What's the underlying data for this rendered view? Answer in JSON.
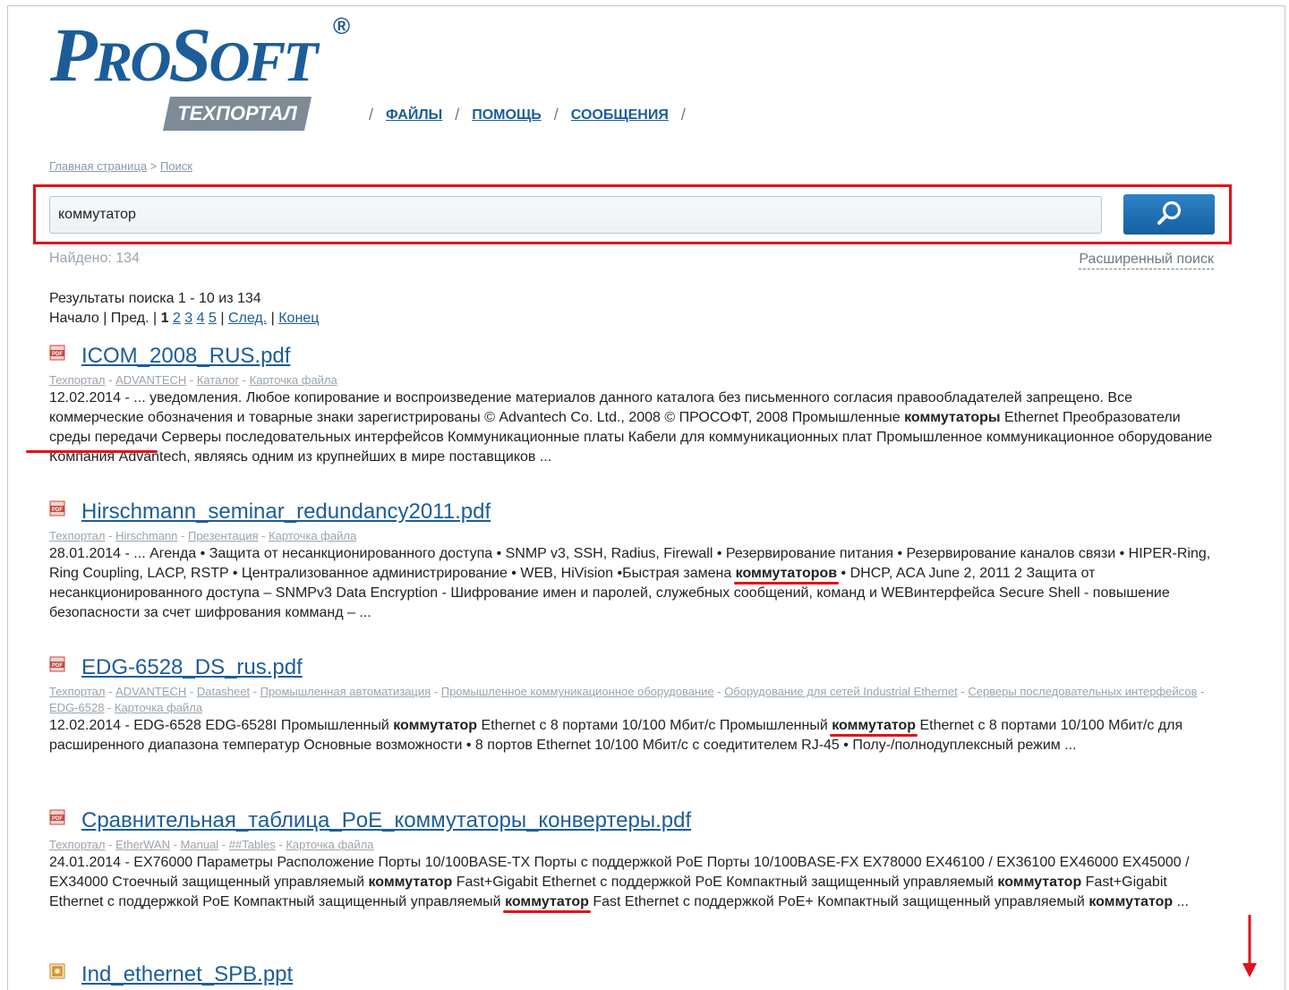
{
  "logo": {
    "word_p": "P",
    "word_ro": "RO",
    "word_s": "S",
    "word_oft": "OFT",
    "reg": "®",
    "band": "ТЕХПОРТАЛ"
  },
  "nav": {
    "items": [
      "ФАЙЛЫ",
      "ПОМОЩЬ",
      "СООБЩЕНИЯ"
    ],
    "sep": "/"
  },
  "breadcrumb": {
    "home": "Главная страница",
    "sep": " > ",
    "current": "Поиск"
  },
  "search": {
    "value": "коммутатор",
    "button_icon": "magnifier-icon"
  },
  "found": "Найдено: 134",
  "advanced": "Расширенный поиск",
  "summary": {
    "line1": "Результаты поиска 1 - 10 из 134",
    "start": "Начало",
    "prev": "Пред.",
    "current_page": "1",
    "pages": [
      "2",
      "3",
      "4",
      "5"
    ],
    "next": "След.",
    "end": "Конец"
  },
  "results": [
    {
      "title": "ICOM_2008_RUS.pdf",
      "icon": "pdf-icon",
      "path": [
        "Техпортал",
        "ADVANTECH",
        "Каталог",
        "Карточка файла"
      ],
      "snippet": [
        {
          "t": "12.02.2014 - ... уведомления. Любое копирование и воспроизведение материалов данного каталога без письменного согласия правообладателей запрещено. Все коммерческие обозначения и товарные знаки зарегистрированы © Advantech Co. Ltd., 2008 © ПРОСОФТ, 2008 Промышленные "
        },
        {
          "t": "коммутаторы",
          "b": true
        },
        {
          "t": " Ethernet Преобразователи среды передачи Серверы последовательных интерфейсов Коммуникационные платы Кабели для коммуникационных плат Промышленное коммуникационное оборудование Компания Advantech, являясь одним из крупнейших в мире поставщиков ..."
        }
      ]
    },
    {
      "title": "Hirschmann_seminar_redundancy2011.pdf",
      "icon": "pdf-icon",
      "path": [
        "Техпортал",
        "Hirschmann",
        "Презентация",
        "Карточка файла"
      ],
      "snippet": [
        {
          "t": "28.01.2014 - ... Агенда • Защита от несанкционированного доступа • SNMP v3, SSH, Radius, Firewall • Резервирование питания • Резервирование каналов связи • HIPER-Ring, Ring Coupling, LACP, RSTP • Централизованное администрирование • WEB, HiVision •Быстрая замена "
        },
        {
          "t": "коммутаторов",
          "b": true,
          "m": true
        },
        {
          "t": " • DHCP, ACA June 2, 2011 2 Защита от несанкционированного доступа – SNMPv3 Data Encryption - Шифрование имен и паролей, служебных сообщений, команд и WEBинтерфейса Secure Shell - повышение безопасности за счет шифрования комманд – ..."
        }
      ]
    },
    {
      "title": "EDG-6528_DS_rus.pdf",
      "icon": "pdf-icon",
      "path": [
        "Техпортал",
        "ADVANTECH",
        "Datasheet",
        "Промышленная автоматизация",
        "Промышленное коммуникационное оборудование",
        "Оборудование для сетей Industrial Ethernet",
        "Серверы последовательных интерфейсов",
        "EDG-6528",
        "Карточка файла"
      ],
      "snippet": [
        {
          "t": "12.02.2014 - EDG-6528 EDG-6528I Промышленный "
        },
        {
          "t": "коммутатор",
          "b": true
        },
        {
          "t": " Ethernet с 8 портами 10/100 Мбит/с Промышленный "
        },
        {
          "t": "коммутатор",
          "b": true,
          "m": true
        },
        {
          "t": " Ethernet с 8 портами 10/100 Мбит/с для расширенного диапазона температур Основные возможности • 8 портов Ethernet 10/100 Мбит/с с соедитителем RJ-45 • Полу-/полнодуплексный режим ..."
        }
      ]
    },
    {
      "title": "Сравнительная_таблица_PoE_коммутаторы_конвертеры.pdf",
      "icon": "pdf-icon",
      "path": [
        "Техпортал",
        "EtherWAN",
        "Manual",
        "##Tables",
        "Карточка файла"
      ],
      "snippet": [
        {
          "t": "24.01.2014 - EX76000 Параметры Расположение Порты 10/100BASE-TX Порты с поддержкой PoE Порты 10/100BASE-FX EX78000 EX46100 / EX36100 EX46000 EX45000 / EX34000 Стоечный защищенный управляемый "
        },
        {
          "t": "коммутатор",
          "b": true
        },
        {
          "t": " Fast+Gigabit Ethernet с поддержкой PoE Компактный защищенный управляемый "
        },
        {
          "t": "коммутатор",
          "b": true
        },
        {
          "t": " Fast+Gigabit Ethernet с поддержкой PoE Компактный защищенный управляемый "
        },
        {
          "t": "коммутатор",
          "b": true,
          "m": true
        },
        {
          "t": " Fast Ethernet с поддержкой PoE+ Компактный защищенный управляемый "
        },
        {
          "t": "коммутатор",
          "b": true
        },
        {
          "t": " ..."
        }
      ]
    },
    {
      "title": "Ind_ethernet_SPB.ppt",
      "icon": "ppt-icon",
      "path": [],
      "snippet": []
    }
  ]
}
